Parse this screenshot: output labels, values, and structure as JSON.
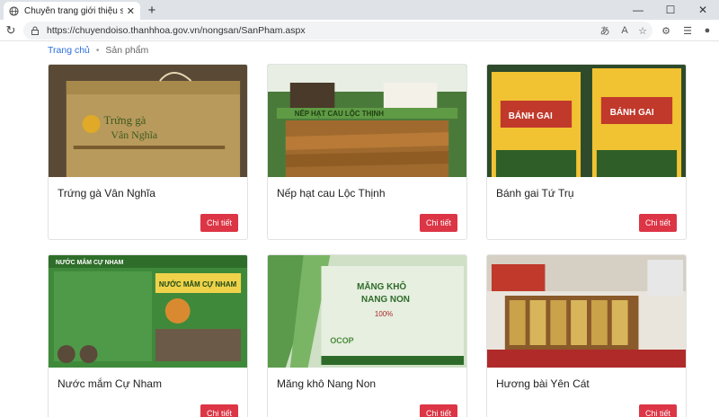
{
  "browser": {
    "tab_title": "Chuyên trang giới thiệu sản phẩm",
    "url": "https://chuyendoiso.thanhhoa.gov.vn/nongsan/SanPham.aspx"
  },
  "breadcrumb": {
    "home": "Trang chủ",
    "current": "Sản phẩm"
  },
  "products": [
    {
      "name": "Trứng gà Vân Nghĩa",
      "button": "Chi tiết",
      "image_text": "Trứng gà Vân Nghĩa"
    },
    {
      "name": "Nếp hạt cau Lộc Thịnh",
      "button": "Chi tiết",
      "image_text": "NẾP HẠT CAU LỘC THỊNH"
    },
    {
      "name": "Bánh gai Tứ Trụ",
      "button": "Chi tiết",
      "image_text": "BÁNH GAI TỨ TRỤ"
    },
    {
      "name": "Nước mắm Cự Nham",
      "button": "Chi tiết",
      "image_text": "NƯỚC MẮM CỰ NHAM"
    },
    {
      "name": "Măng khô Nang Non",
      "button": "Chi tiết",
      "image_text": "MĂNG KHÔ NANG NON"
    },
    {
      "name": "Hương bài Yên Cát",
      "button": "Chi tiết",
      "image_text": ""
    }
  ],
  "colors": {
    "button": "#dc3545",
    "link": "#2a6fdb"
  }
}
